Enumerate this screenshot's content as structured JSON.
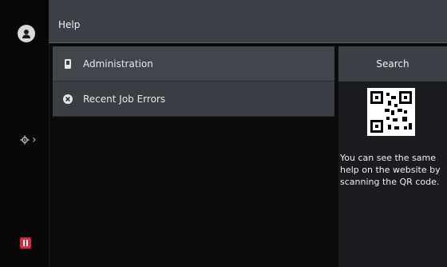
{
  "header": {
    "title": "Help"
  },
  "list": {
    "items": [
      {
        "label": "Administration",
        "icon": "device-icon"
      },
      {
        "label": "Recent Job Errors",
        "icon": "error-circle-icon"
      }
    ]
  },
  "right_panel": {
    "search_label": "Search",
    "help_text": "You can see the same\nhelp on the website by\nscanning the QR code."
  },
  "colors": {
    "header_bg": "#3b3f46",
    "list_bg": "#3a3d43",
    "accent_red": "#d7283c"
  }
}
